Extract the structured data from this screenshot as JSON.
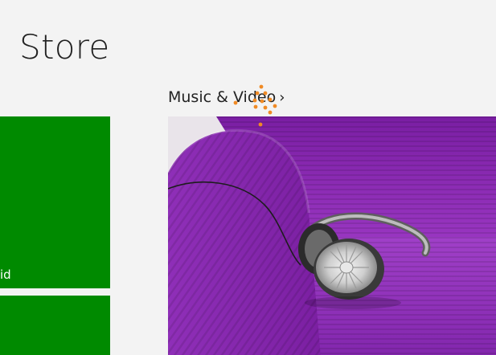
{
  "app": {
    "title": "Store"
  },
  "tiles": [
    {
      "label": "id"
    },
    {
      "label": ""
    }
  ],
  "group": {
    "header": "Music & Video",
    "chevron": "›"
  },
  "icons": {
    "loading": "loading-dots-icon",
    "chevron": "chevron-right-icon"
  },
  "colors": {
    "tile_green": "#008a00",
    "background": "#f3f3f3",
    "sofa_purple": "#8a2bb0",
    "spinner_orange": "#f08a24"
  }
}
